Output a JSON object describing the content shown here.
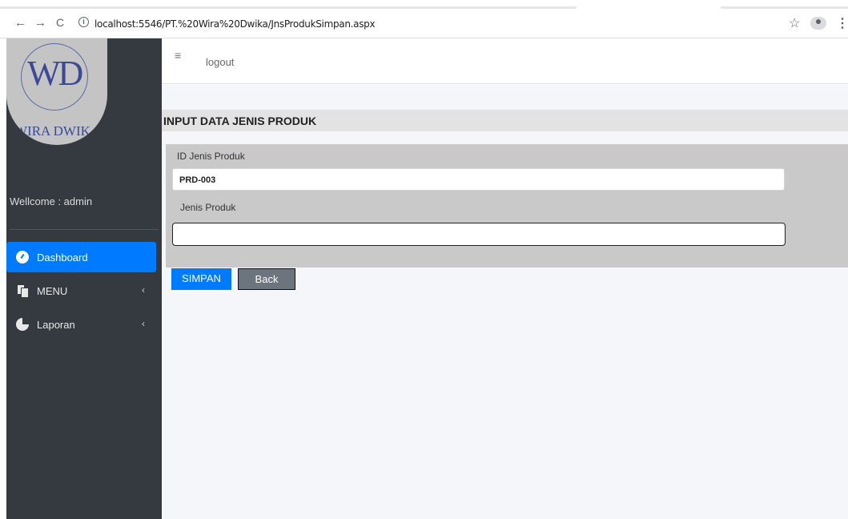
{
  "browser": {
    "url": "localhost:5546/PT.%20Wira%20Dwika/JnsProdukSimpan.aspx",
    "back_icon": "arrow-left",
    "forward_icon": "arrow-right",
    "reload_icon": "reload",
    "info_icon": "info",
    "info_glyph": "i"
  },
  "sidebar": {
    "logo_text": "WD",
    "logo_sub": "WIRA DWIK",
    "welcome": "Wellcome : admin",
    "items": [
      {
        "label": "Dashboard",
        "icon": "dashboard-icon",
        "active": true
      },
      {
        "label": "MENU",
        "icon": "files-icon",
        "chevron": "‹"
      },
      {
        "label": "Laporan",
        "icon": "pie-chart-icon",
        "chevron": "‹"
      }
    ]
  },
  "header": {
    "menu_glyph": "≡",
    "logout": "logout"
  },
  "main": {
    "title": "INPUT DATA JENIS PRODUK",
    "fields": [
      {
        "label": "ID Jenis Produk",
        "value": "PRD-003"
      },
      {
        "label": "Jenis Produk",
        "value": ""
      }
    ],
    "buttons": {
      "save": "SIMPAN",
      "back": "Back"
    }
  },
  "colors": {
    "sidebar_bg": "#343a40",
    "accent": "#007bff",
    "panel_bg": "#c9c9c9",
    "secondary_btn": "#6c757d"
  }
}
